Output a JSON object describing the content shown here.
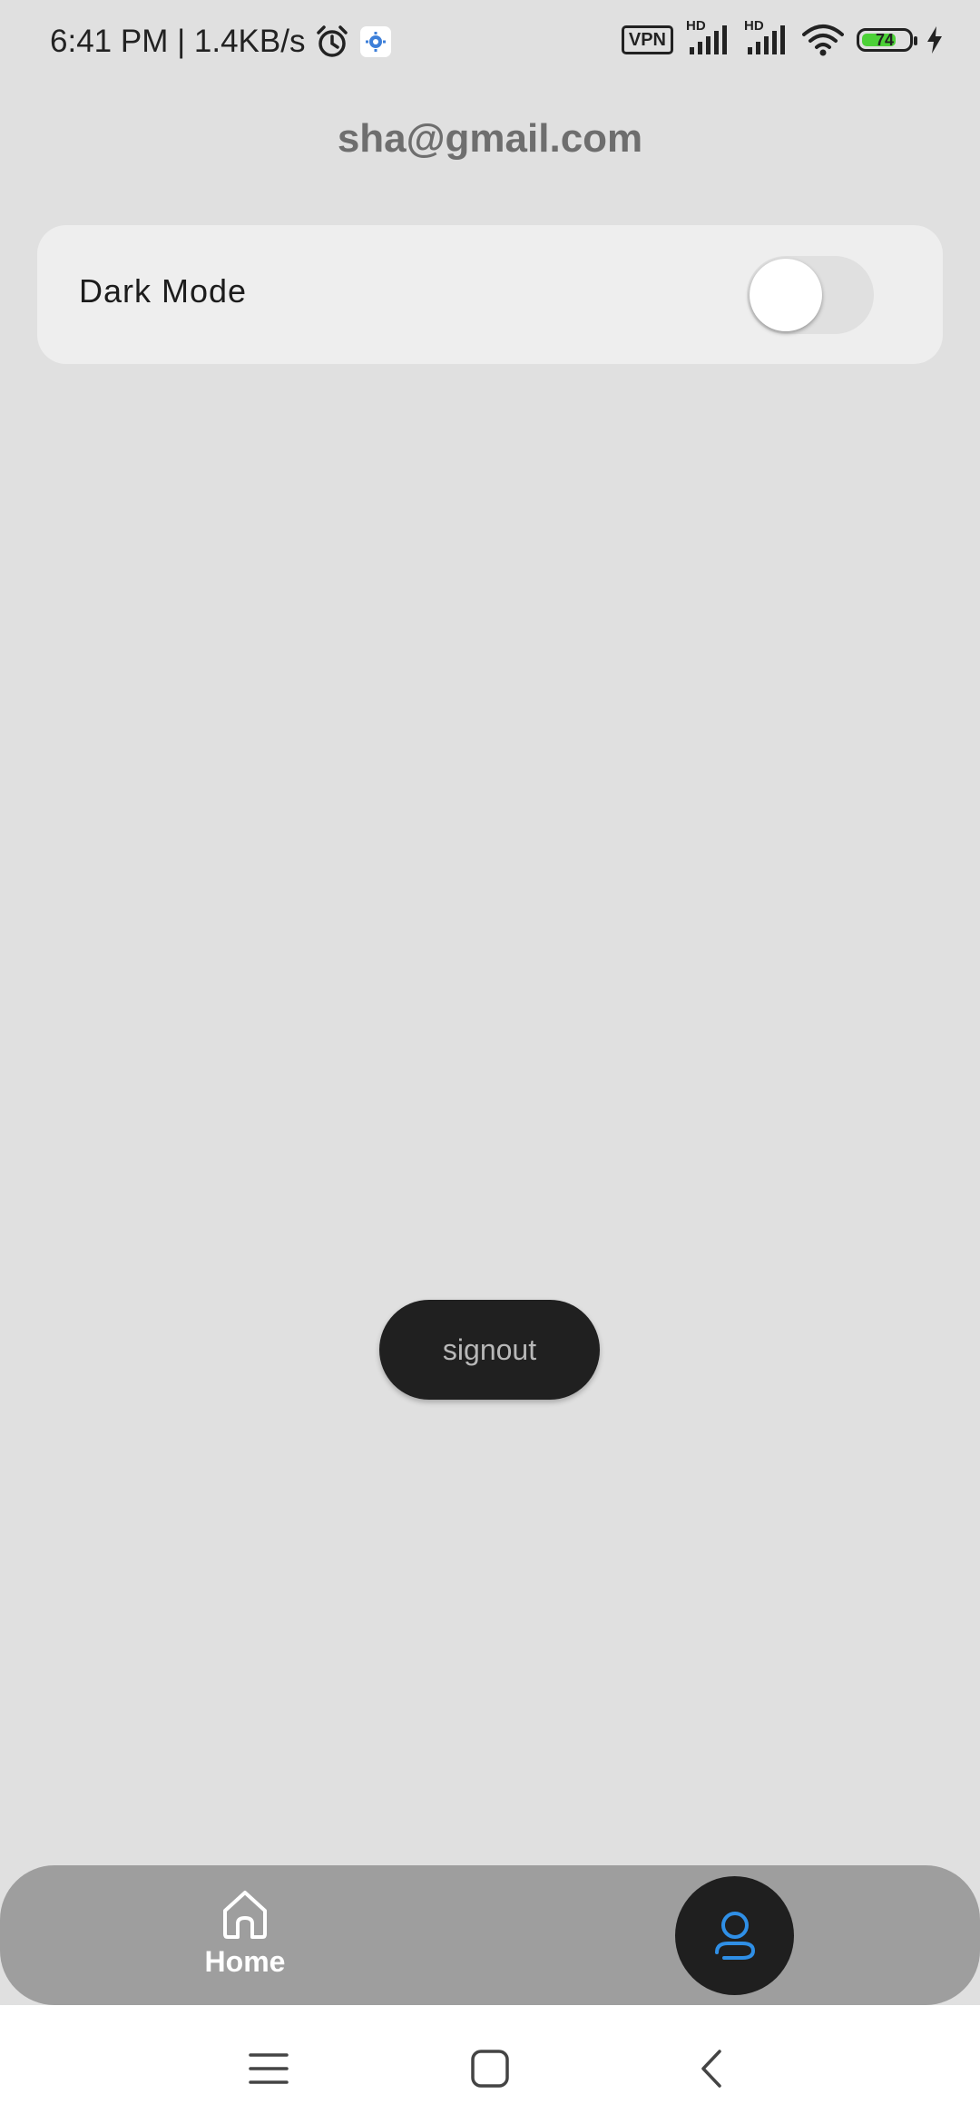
{
  "status_bar": {
    "time_speed": "6:41 PM | 1.4KB/s",
    "vpn_label": "VPN",
    "network_1": "HD",
    "network_2": "HD",
    "battery_level": "74",
    "battery_fraction": 0.74,
    "battery_color": "#4cd137",
    "icons": [
      "alarm-icon",
      "settings-notification-icon",
      "signal-icon",
      "wifi-icon",
      "charging-icon"
    ]
  },
  "header": {
    "email": "sha@gmail.com"
  },
  "settings": {
    "dark_mode_label": "Dark Mode",
    "dark_mode_enabled": false
  },
  "actions": {
    "signout_label": "signout"
  },
  "bottom_nav": {
    "home_label": "Home",
    "active_tab": "profile",
    "active_icon_color": "#2f8fe6"
  },
  "system_nav": {
    "buttons": [
      "menu-icon",
      "home-square-icon",
      "back-icon"
    ]
  }
}
